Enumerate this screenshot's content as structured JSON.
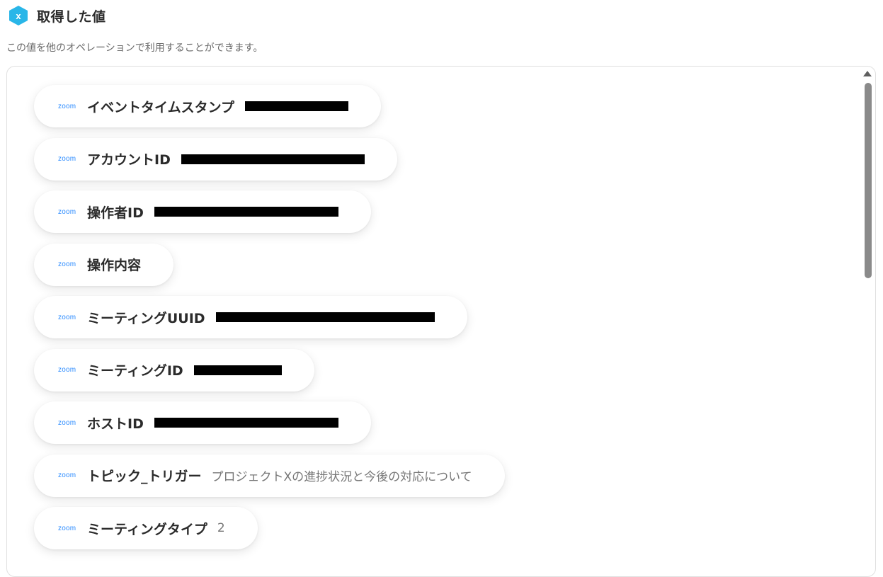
{
  "header": {
    "title": "取得した値",
    "icon": "yoom-x-hexagon-icon",
    "icon_color": "#29b6e8"
  },
  "description": "この値を他のオペレーションで利用することができます。",
  "items": [
    {
      "label": "イベントタイムスタンプ",
      "value": "",
      "redacted": true
    },
    {
      "label": "アカウントID",
      "value": "",
      "redacted": true
    },
    {
      "label": "操作者ID",
      "value": "",
      "redacted": true
    },
    {
      "label": "操作内容",
      "value": "",
      "redacted": false
    },
    {
      "label": "ミーティングUUID",
      "value": "",
      "redacted": true
    },
    {
      "label": "ミーティングID",
      "value": "",
      "redacted": true
    },
    {
      "label": "ホストID",
      "value": "",
      "redacted": true
    },
    {
      "label": "トピック_トリガー",
      "value": "プロジェクトXの進捗状況と今後の対応について",
      "redacted": false
    },
    {
      "label": "ミーティングタイプ",
      "value": "2",
      "redacted": false
    }
  ],
  "service_logo": "zoom",
  "colors": {
    "zoom_blue": "#2d8cff",
    "redaction": "#000000"
  }
}
